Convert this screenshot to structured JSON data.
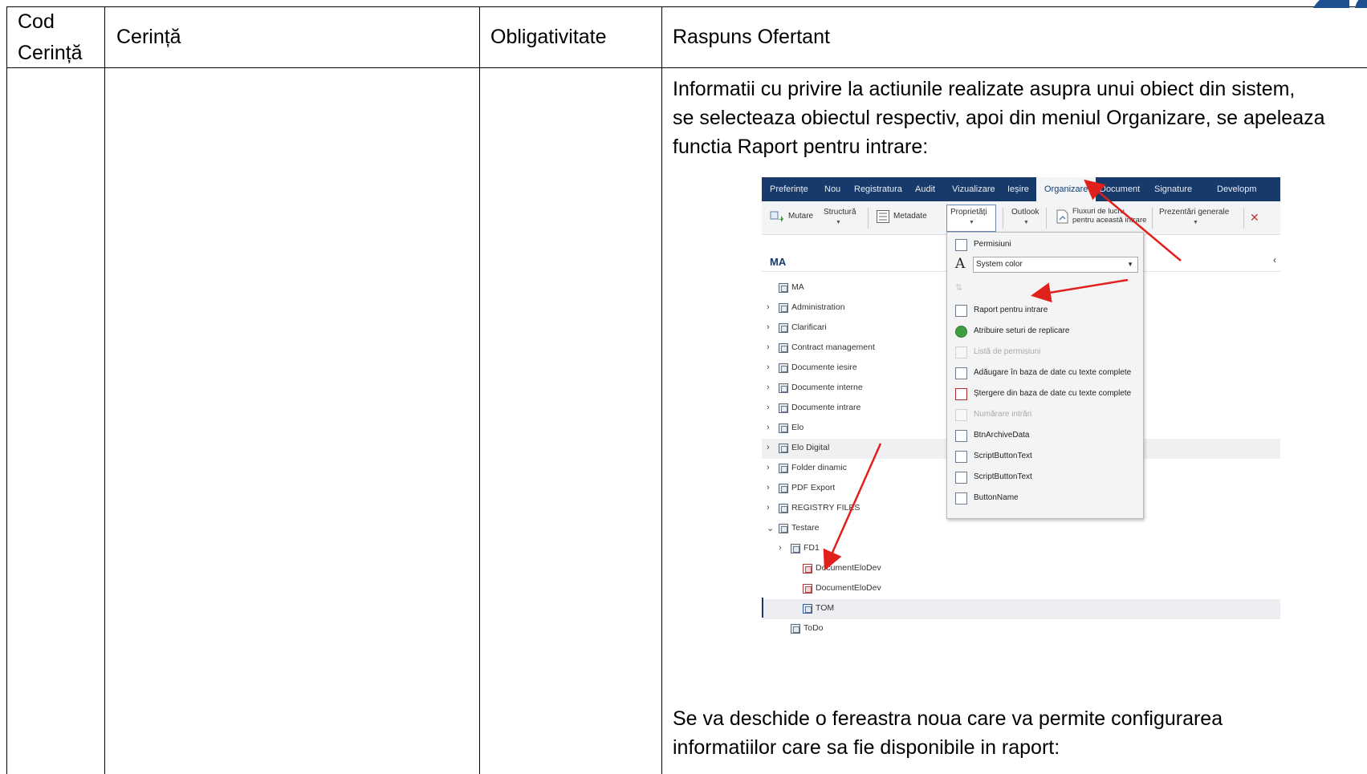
{
  "table": {
    "headers": {
      "cod": "Cod Cerință",
      "cerinta": "Cerință",
      "obligativitate": "Obligativitate",
      "raspuns": "Raspuns Ofertant"
    },
    "intro_lines": [
      "Informatii cu privire la actiunile realizate asupra unui obiect din sistem,",
      "se selecteaza obiectul respectiv, apoi din meniul Organizare, se apeleaza",
      "functia Raport pentru intrare:"
    ],
    "outro_lines": [
      "Se va deschide o fereastra noua care va permite configurarea",
      "informatiilor care sa fie disponibile in raport:"
    ]
  },
  "screenshot": {
    "ribbon_tabs": [
      "Preferințe",
      "Nou",
      "Registratura",
      "Audit",
      "Vizualizare",
      "Ieșire",
      "Organizare",
      "Document",
      "Signature",
      "Developm"
    ],
    "active_tab": "Organizare",
    "toolbar": {
      "mutare": "Mutare",
      "structura": "Structură",
      "metadate": "Metadate",
      "proprietati": "Proprietăți",
      "outlook": "Outlook",
      "fluxuri_line1": "Fluxuri de lucru",
      "fluxuri_line2": "pentru această intrare",
      "prezentari": "Prezentări generale"
    },
    "pane_title": "MA",
    "tree": [
      {
        "label": "MA",
        "level": 0,
        "chevron": "",
        "icon": "repository-icon"
      },
      {
        "label": "Administration",
        "level": 0,
        "chevron": "›",
        "icon": "folder-icon"
      },
      {
        "label": "Clarificari",
        "level": 0,
        "chevron": "›",
        "icon": "folder-icon"
      },
      {
        "label": "Contract management",
        "level": 0,
        "chevron": "›",
        "icon": "folder-icon"
      },
      {
        "label": "Documente iesire",
        "level": 0,
        "chevron": "›",
        "icon": "folder-icon"
      },
      {
        "label": "Documente interne",
        "level": 0,
        "chevron": "›",
        "icon": "folder-icon"
      },
      {
        "label": "Documente intrare",
        "level": 0,
        "chevron": "›",
        "icon": "folder-icon"
      },
      {
        "label": "Elo",
        "level": 0,
        "chevron": "›",
        "icon": "folder-icon"
      },
      {
        "label": "Elo Digital",
        "level": 0,
        "chevron": "›",
        "icon": "folder-icon"
      },
      {
        "label": "Folder dinamic",
        "level": 0,
        "chevron": "›",
        "icon": "folder-icon"
      },
      {
        "label": "PDF Export",
        "level": 0,
        "chevron": "›",
        "icon": "folder-icon"
      },
      {
        "label": "REGISTRY FILES",
        "level": 0,
        "chevron": "›",
        "icon": "folder-icon"
      },
      {
        "label": "Testare",
        "level": 0,
        "chevron": "⌄",
        "icon": "folder-icon"
      },
      {
        "label": "FD1",
        "level": 1,
        "chevron": "›",
        "icon": "folder-icon"
      },
      {
        "label": "DocumentEloDev",
        "level": 2,
        "chevron": "",
        "icon": "document-icon"
      },
      {
        "label": "DocumentEloDev",
        "level": 2,
        "chevron": "",
        "icon": "document-icon"
      },
      {
        "label": "TOM",
        "level": 2,
        "chevron": "",
        "icon": "tom-icon"
      },
      {
        "label": "ToDo",
        "level": 1,
        "chevron": "",
        "icon": "folder-icon"
      }
    ],
    "dropdown": {
      "permisiuni": "Permisiuni",
      "system_color": "System color",
      "items": [
        {
          "label": "Raport pentru intrare",
          "enabled": true,
          "icon": "report-icon"
        },
        {
          "label": "Atribuire seturi de replicare",
          "enabled": true,
          "icon": "replication-icon"
        },
        {
          "label": "Listă de permisiuni",
          "enabled": false,
          "icon": "permissions-list-icon"
        },
        {
          "label": "Adăugare în baza de date cu texte complete",
          "enabled": true,
          "icon": "fulltext-add-icon"
        },
        {
          "label": "Ștergere din baza de date cu texte complete",
          "enabled": true,
          "icon": "fulltext-delete-icon"
        },
        {
          "label": "Numărare intrări",
          "enabled": false,
          "icon": "count-icon"
        },
        {
          "label": "BtnArchiveData",
          "enabled": true,
          "icon": "archive-icon"
        },
        {
          "label": "ScriptButtonText",
          "enabled": true,
          "icon": "script-icon"
        },
        {
          "label": "ScriptButtonText",
          "enabled": true,
          "icon": "script-icon"
        },
        {
          "label": "ButtonName",
          "enabled": true,
          "icon": "button-icon"
        }
      ]
    },
    "colors": {
      "ribbon": "#173a6a",
      "annotation_arrow": "#e0201b"
    }
  }
}
